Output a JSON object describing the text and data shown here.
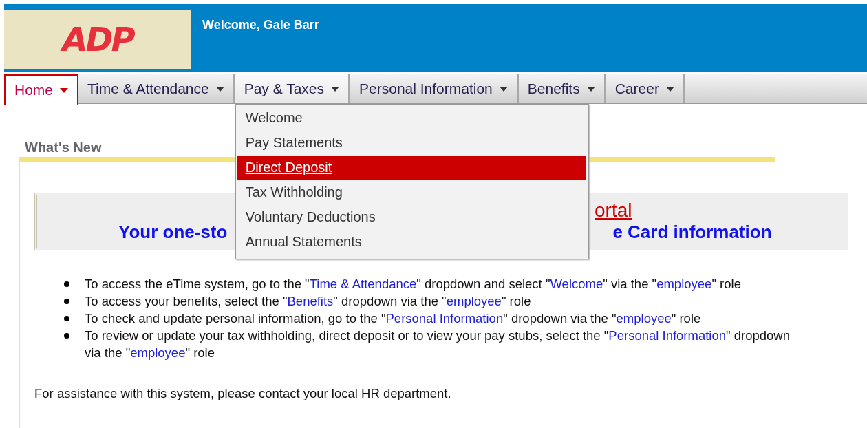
{
  "header": {
    "logo": "ADP",
    "welcome": "Welcome, Gale Barr"
  },
  "tabs": [
    {
      "label": "Home",
      "selected": true,
      "expanded": false
    },
    {
      "label": "Time & Attendance",
      "selected": false,
      "expanded": false
    },
    {
      "label": "Pay & Taxes",
      "selected": false,
      "expanded": true,
      "menu": [
        {
          "label": "Welcome",
          "selected": false
        },
        {
          "label": "Pay Statements",
          "selected": false
        },
        {
          "label": "Direct Deposit",
          "selected": true
        },
        {
          "label": "Tax Withholding",
          "selected": false
        },
        {
          "label": "Voluntary Deductions",
          "selected": false
        },
        {
          "label": "Annual Statements",
          "selected": false
        }
      ]
    },
    {
      "label": "Personal Information",
      "selected": false,
      "expanded": false
    },
    {
      "label": "Benefits",
      "selected": false,
      "expanded": false
    },
    {
      "label": "Career",
      "selected": false,
      "expanded": false
    }
  ],
  "section_title": "What's New",
  "banner": {
    "link_fragment": "ortal",
    "subtitle_start": "Your one-sto",
    "subtitle_end": "e Card information"
  },
  "bullets": [
    [
      {
        "kind": "plain",
        "text": "To access the eTime system, go to the \""
      },
      {
        "kind": "term",
        "text": "Time & Attendance"
      },
      {
        "kind": "plain",
        "text": "\" dropdown and select \""
      },
      {
        "kind": "term",
        "text": "Welcome"
      },
      {
        "kind": "plain",
        "text": "\" via the \""
      },
      {
        "kind": "term",
        "text": "employee"
      },
      {
        "kind": "plain",
        "text": "\" role"
      }
    ],
    [
      {
        "kind": "plain",
        "text": "To access your benefits, select the \""
      },
      {
        "kind": "term",
        "text": "Benefits"
      },
      {
        "kind": "plain",
        "text": "\" dropdown via the \""
      },
      {
        "kind": "term",
        "text": "employee"
      },
      {
        "kind": "plain",
        "text": "\" role"
      }
    ],
    [
      {
        "kind": "plain",
        "text": "To check and update personal information, go to the \""
      },
      {
        "kind": "term",
        "text": "Personal Information"
      },
      {
        "kind": "plain",
        "text": "\" dropdown via the \""
      },
      {
        "kind": "term",
        "text": "employee"
      },
      {
        "kind": "plain",
        "text": "\" role"
      }
    ],
    [
      {
        "kind": "plain",
        "text": "To review or update your tax withholding, direct deposit or to view your pay stubs, select the \""
      },
      {
        "kind": "term",
        "text": "Personal Information"
      },
      {
        "kind": "plain",
        "text": "\" dropdown via the \""
      },
      {
        "kind": "term",
        "text": "employee"
      },
      {
        "kind": "plain",
        "text": "\" role"
      }
    ]
  ],
  "footer_note": "For assistance with this system, please contact your local HR department."
}
